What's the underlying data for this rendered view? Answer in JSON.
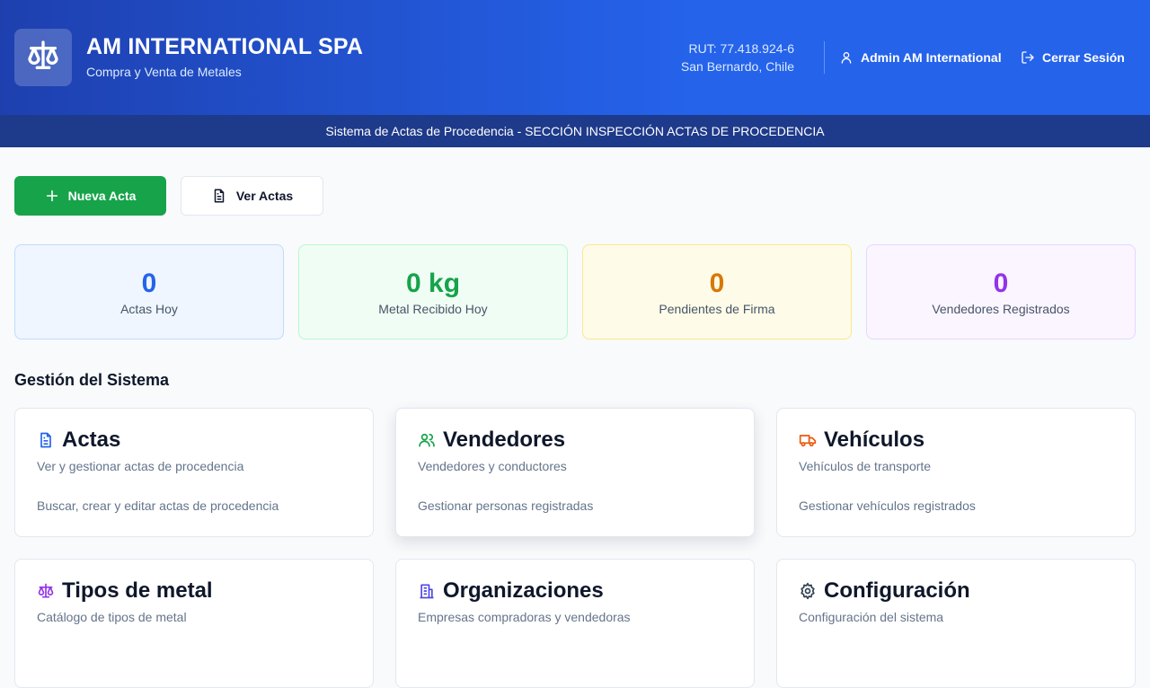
{
  "header": {
    "brand_title": "AM INTERNATIONAL SPA",
    "brand_subtitle": "Compra y Venta de Metales",
    "rut": "RUT: 77.418.924-6",
    "location": "San Bernardo, Chile",
    "user_name": "Admin AM International",
    "logout_label": "Cerrar Sesión"
  },
  "banner": {
    "text": "Sistema de Actas de Procedencia - SECCIÓN INSPECCIÓN ACTAS DE PROCEDENCIA"
  },
  "actions": {
    "new_label": "Nueva Acta",
    "view_label": "Ver Actas"
  },
  "stats": [
    {
      "value": "0",
      "label": "Actas Hoy",
      "color": "#2563eb"
    },
    {
      "value": "0 kg",
      "label": "Metal Recibido Hoy",
      "color": "#16a34a"
    },
    {
      "value": "0",
      "label": "Pendientes de Firma",
      "color": "#d97706"
    },
    {
      "value": "0",
      "label": "Vendedores Registrados",
      "color": "#9333ea"
    }
  ],
  "section": {
    "title": "Gestión del Sistema"
  },
  "cards": [
    {
      "title": "Actas",
      "description": "Ver y gestionar actas de procedencia",
      "detail": "Buscar, crear y editar actas de procedencia",
      "icon": "document-icon",
      "color": "#2563eb"
    },
    {
      "title": "Vendedores",
      "description": "Vendedores y conductores",
      "detail": "Gestionar personas registradas",
      "icon": "users-icon",
      "color": "#16a34a"
    },
    {
      "title": "Vehículos",
      "description": "Vehículos de transporte",
      "detail": "Gestionar vehículos registrados",
      "icon": "truck-icon",
      "color": "#ea580c"
    },
    {
      "title": "Tipos de metal",
      "description": "Catálogo de tipos de metal",
      "detail": "",
      "icon": "scale-icon",
      "color": "#9333ea"
    },
    {
      "title": "Organizaciones",
      "description": "Empresas compradoras y vendedoras",
      "detail": "",
      "icon": "building-icon",
      "color": "#4f46e5"
    },
    {
      "title": "Configuración",
      "description": "Configuración del sistema",
      "detail": "",
      "icon": "gear-icon",
      "color": "#334155"
    }
  ]
}
